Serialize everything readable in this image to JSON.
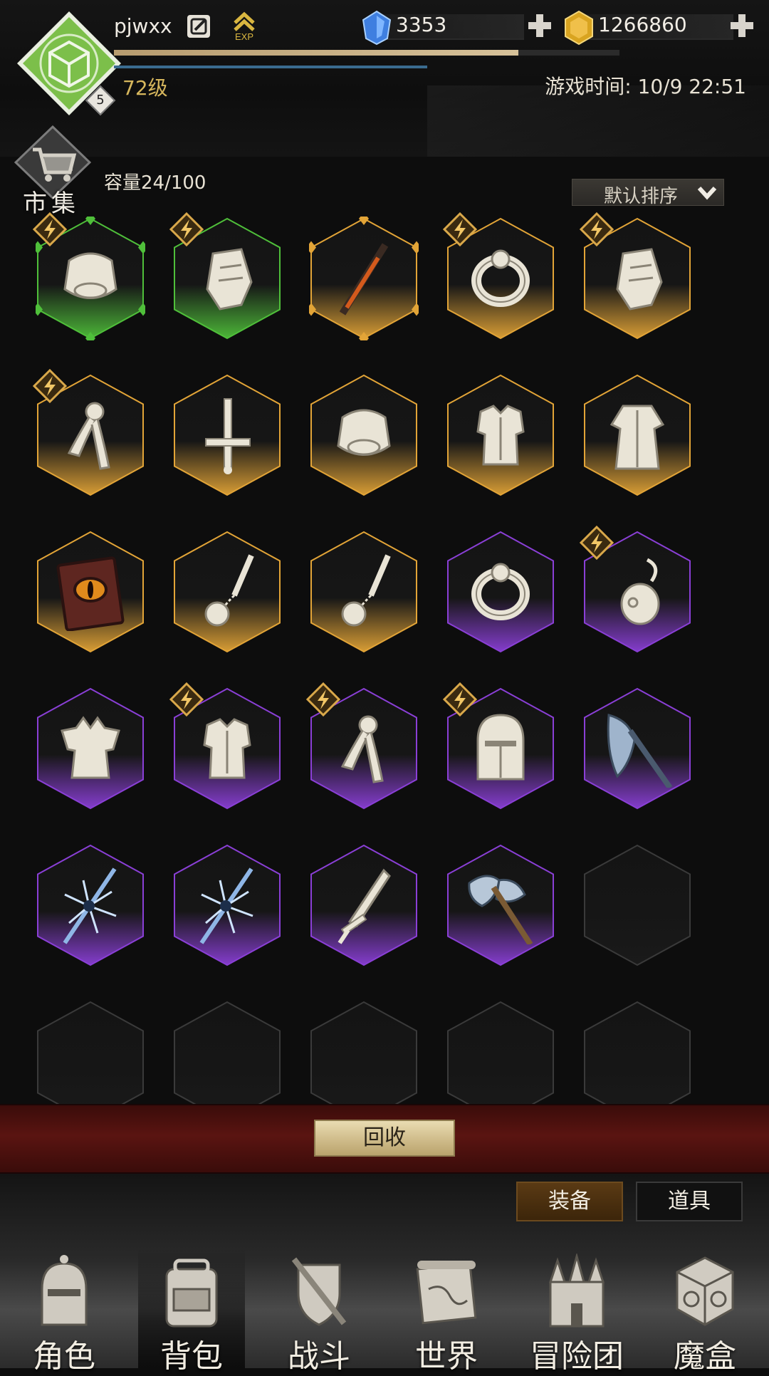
{
  "player": {
    "name": "pjwxx",
    "level_label": "72级",
    "rank_badge": "5",
    "exp_fraction": 0.8
  },
  "currency": {
    "gems": "3353",
    "gold": "1266860"
  },
  "game_time_label": "游戏时间: 10/9 22:51",
  "market": {
    "label": "市集"
  },
  "inventory": {
    "capacity_label": "容量24/100",
    "sort_label": "默认排序",
    "rarity_colors": {
      "green": "#4fbf3a",
      "gold": "#e2a437",
      "purple": "#8a3fd6",
      "empty": "#3a3a3a"
    },
    "slots": [
      {
        "item": "chest-armor-icon",
        "rarity": "green",
        "starred": true,
        "ornate": true
      },
      {
        "item": "gauntlet-icon",
        "rarity": "green",
        "starred": true
      },
      {
        "item": "flame-sword-icon",
        "rarity": "gold",
        "starred": false,
        "ornate": true
      },
      {
        "item": "ring-icon",
        "rarity": "gold",
        "starred": true
      },
      {
        "item": "gauntlet-icon",
        "rarity": "gold",
        "starred": true
      },
      {
        "item": "scarf-icon",
        "rarity": "gold",
        "starred": true
      },
      {
        "item": "cross-sword-icon",
        "rarity": "gold",
        "starred": false
      },
      {
        "item": "chest-armor-icon",
        "rarity": "gold",
        "starred": false
      },
      {
        "item": "body-armor-icon",
        "rarity": "gold",
        "starred": false
      },
      {
        "item": "robe-icon",
        "rarity": "gold",
        "starred": false
      },
      {
        "item": "eye-tome-icon",
        "rarity": "gold",
        "starred": false
      },
      {
        "item": "flail-icon",
        "rarity": "gold",
        "starred": false
      },
      {
        "item": "flail-icon",
        "rarity": "gold",
        "starred": false
      },
      {
        "item": "ring-icon",
        "rarity": "purple",
        "starred": false
      },
      {
        "item": "earring-icon",
        "rarity": "purple",
        "starred": true
      },
      {
        "item": "spiked-armor-icon",
        "rarity": "purple",
        "starred": false
      },
      {
        "item": "body-armor-icon",
        "rarity": "purple",
        "starred": true
      },
      {
        "item": "scarf-icon",
        "rarity": "purple",
        "starred": true
      },
      {
        "item": "helmet-icon",
        "rarity": "purple",
        "starred": true
      },
      {
        "item": "battle-axe-icon",
        "rarity": "purple",
        "starred": false
      },
      {
        "item": "ice-staff-icon",
        "rarity": "purple",
        "starred": false
      },
      {
        "item": "ice-staff-icon",
        "rarity": "purple",
        "starred": false
      },
      {
        "item": "sword-icon",
        "rarity": "purple",
        "starred": false
      },
      {
        "item": "double-axe-icon",
        "rarity": "purple",
        "starred": false
      },
      {
        "item": "empty-slot",
        "rarity": "empty",
        "starred": false
      },
      {
        "item": "empty-slot",
        "rarity": "empty",
        "starred": false
      },
      {
        "item": "empty-slot",
        "rarity": "empty",
        "starred": false
      },
      {
        "item": "empty-slot",
        "rarity": "empty",
        "starred": false
      },
      {
        "item": "empty-slot",
        "rarity": "empty",
        "starred": false
      },
      {
        "item": "empty-slot",
        "rarity": "empty",
        "starred": false
      }
    ]
  },
  "actions": {
    "recycle_label": "回收"
  },
  "tabs": {
    "equip_label": "装备",
    "items_label": "道具"
  },
  "nav": [
    {
      "key": "role",
      "label": "角色",
      "icon": "helmet-icon"
    },
    {
      "key": "bag",
      "label": "背包",
      "icon": "backpack-icon",
      "active": true
    },
    {
      "key": "battle",
      "label": "战斗",
      "icon": "shield-sword-icon"
    },
    {
      "key": "world",
      "label": "世界",
      "icon": "map-scroll-icon"
    },
    {
      "key": "guild",
      "label": "冒险团",
      "icon": "castle-icon"
    },
    {
      "key": "magicbox",
      "label": "魔盒",
      "icon": "magic-cube-icon"
    }
  ]
}
